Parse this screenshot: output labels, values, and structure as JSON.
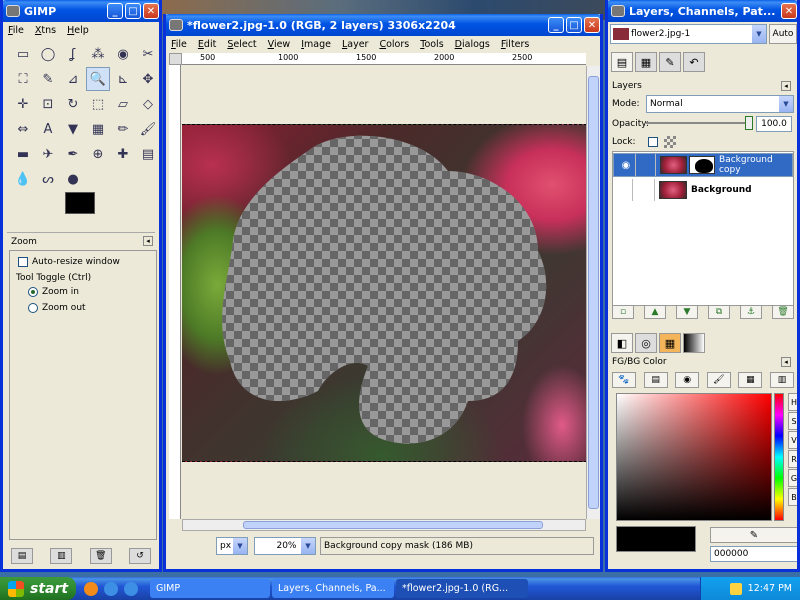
{
  "toolbox": {
    "title": "GIMP",
    "menu": [
      "File",
      "Xtns",
      "Help"
    ],
    "tool_icons": [
      "rect-select-icon",
      "ellipse-select-icon",
      "lasso-icon",
      "magic-wand-icon",
      "color-select-icon",
      "scissors-icon",
      "foreground-select-icon",
      "paths-icon",
      "color-picker-icon",
      "zoom-icon",
      "measure-icon",
      "move-icon",
      "align-icon",
      "crop-icon",
      "rotate-icon",
      "scale-icon",
      "shear-icon",
      "perspective-icon",
      "flip-icon",
      "text-icon",
      "bucket-fill-icon",
      "blend-icon",
      "pencil-icon",
      "paintbrush-icon",
      "eraser-icon",
      "airbrush-icon",
      "ink-icon",
      "clone-icon",
      "heal-icon",
      "perspective-clone-icon",
      "blur-icon",
      "smudge-icon",
      "dodge-burn-icon"
    ],
    "tool_glyphs": [
      "▭",
      "◯",
      "ʆ",
      "⁂",
      "◉",
      "✂",
      "⛶",
      "✎",
      "⊿",
      "🔍",
      "⊾",
      "✥",
      "✛",
      "⊡",
      "↻",
      "⬚",
      "▱",
      "◇",
      "⇔",
      "A",
      "▼",
      "▦",
      "✏",
      "🖌",
      "▬",
      "✈",
      "✒",
      "⊕",
      "✚",
      "▤",
      "💧",
      "ᔕ",
      "●"
    ],
    "active_tool_index": 9,
    "options_title": "Zoom",
    "auto_resize_label": "Auto-resize window",
    "tool_toggle_label": "Tool Toggle  (Ctrl)",
    "zoom_in_label": "Zoom in",
    "zoom_out_label": "Zoom out"
  },
  "image_window": {
    "title": "*flower2.jpg-1.0 (RGB, 2 layers) 3306x2204",
    "menu": [
      "File",
      "Edit",
      "Select",
      "View",
      "Image",
      "Layer",
      "Colors",
      "Tools",
      "Dialogs",
      "Filters"
    ],
    "ruler_labels": [
      "500",
      "1000",
      "1500",
      "2000",
      "2500"
    ],
    "vruler_labels": [
      "5\n0\n0",
      "1\n0\n0\n0",
      "1\n5\n0\n0",
      "2\n0\n0\n0"
    ],
    "unit": "px",
    "zoom": "20%",
    "status": "Background copy mask (186 MB)"
  },
  "layers_dock": {
    "title": "Layers, Channels, Pat...",
    "image_select": "flower2.jpg-1",
    "auto_label": "Auto",
    "section_label": "Layers",
    "mode_label": "Mode:",
    "mode_value": "Normal",
    "opacity_label": "Opacity:",
    "opacity_value": "100.0",
    "lock_label": "Lock:",
    "layers": [
      {
        "name": "Background copy",
        "visible": true,
        "selected": true,
        "has_mask": true
      },
      {
        "name": "Background",
        "visible": false,
        "selected": false,
        "has_mask": false
      }
    ],
    "fgbg_label": "FG/BG Color",
    "channel_buttons": [
      "H",
      "S",
      "V",
      "R",
      "G",
      "B"
    ],
    "hex_value": "000000"
  },
  "taskbar": {
    "start_label": "start",
    "tasks": [
      "GIMP",
      "Layers, Channels, Pa...",
      "*flower2.jpg-1.0 (RG..."
    ],
    "active_task_index": 2,
    "clock": "12:47 PM"
  }
}
